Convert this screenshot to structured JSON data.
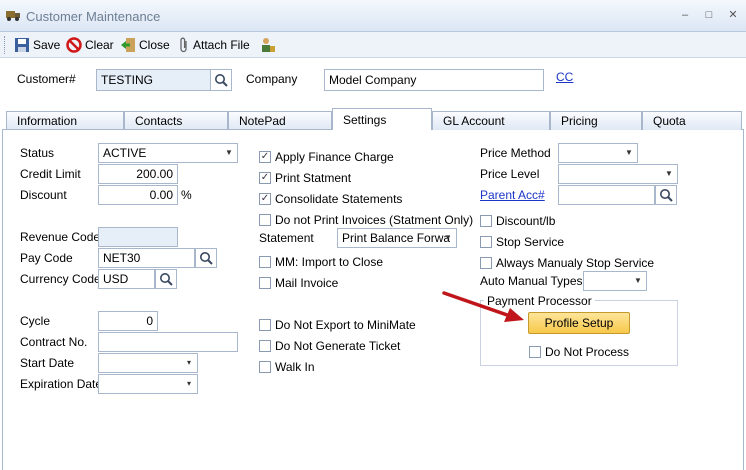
{
  "window": {
    "title": "Customer Maintenance",
    "min": "–",
    "max": "□",
    "close": "✕"
  },
  "toolbar": {
    "save": "Save",
    "clear": "Clear",
    "close": "Close",
    "attach": "Attach File"
  },
  "header": {
    "customer_label": "Customer#",
    "customer_value": "TESTING",
    "company_label": "Company",
    "company_value": "Model Company",
    "cc_link": "CC"
  },
  "tabs": [
    "Information",
    "Contacts",
    "NotePad",
    "Settings",
    "GL Account",
    "Pricing",
    "Quota"
  ],
  "left": {
    "status_label": "Status",
    "status_value": "ACTIVE",
    "credit_label": "Credit Limit",
    "credit_value": "200.00",
    "discount_label": "Discount",
    "discount_value": "0.00",
    "discount_unit": "%",
    "revenue_label": "Revenue Code",
    "revenue_value": "",
    "pay_label": "Pay Code",
    "pay_value": "NET30",
    "currency_label": "Currency Code",
    "currency_value": "USD",
    "cycle_label": "Cycle",
    "cycle_value": "0",
    "contract_label": "Contract No.",
    "contract_value": "",
    "start_label": "Start Date",
    "start_value": "",
    "exp_label": "Expiration Date",
    "exp_value": ""
  },
  "middle": {
    "apply_finance": {
      "label": "Apply Finance Charge",
      "checked": true
    },
    "print_statment": {
      "label": "Print Statment",
      "checked": true
    },
    "consolidate": {
      "label": "Consolidate Statements",
      "checked": true
    },
    "no_print_invoices": {
      "label": "Do not Print Invoices (Statment Only)",
      "checked": false
    },
    "statement_label": "Statement",
    "statement_value": "Print Balance Forwa",
    "mm_import": {
      "label": "MM:  Import to Close",
      "checked": false
    },
    "mail_invoice": {
      "label": "Mail Invoice",
      "checked": false
    },
    "no_export": {
      "label": "Do Not Export to MiniMate",
      "checked": false
    },
    "no_ticket": {
      "label": "Do Not Generate Ticket",
      "checked": false
    },
    "walk_in": {
      "label": "Walk In",
      "checked": false
    }
  },
  "right": {
    "price_method_label": "Price Method",
    "price_method_value": "",
    "price_level_label": "Price Level",
    "price_level_value": "",
    "parent_label": "Parent Acc#",
    "parent_value": "",
    "discount_lb": {
      "label": "Discount/lb",
      "checked": false
    },
    "stop_service": {
      "label": "Stop Service",
      "checked": false
    },
    "always_stop": {
      "label": "Always Manualy Stop Service",
      "checked": false
    },
    "auto_manual_label": "Auto Manual Types",
    "auto_manual_value": "",
    "payment_group": "Payment Processor",
    "profile_setup": "Profile Setup",
    "do_not_process": {
      "label": "Do Not Process",
      "checked": false
    }
  },
  "colors": {
    "accent_button": "#f7c84a",
    "arrow": "#c0161b",
    "link": "#1c35c8"
  }
}
